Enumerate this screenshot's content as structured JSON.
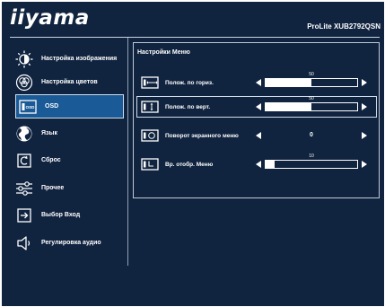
{
  "brand": "iiyama",
  "model": "ProLite XUB2792QSN",
  "colors": {
    "background": "#10233f",
    "selected": "#1a5a96",
    "text": "#ffffff"
  },
  "menu": [
    {
      "label": "Настройка изображения",
      "icon": "sun-brightness-icon"
    },
    {
      "label": "Настройка цветов",
      "icon": "rgb-color-icon"
    },
    {
      "label": "OSD",
      "icon": "osd-icon",
      "selected": true
    },
    {
      "label": "Язык",
      "icon": "globe-icon"
    },
    {
      "label": "Сброс",
      "icon": "reset-icon"
    },
    {
      "label": "Прочее",
      "icon": "sliders-icon"
    },
    {
      "label": "Выбор Вход",
      "icon": "input-icon"
    },
    {
      "label": "Регулировка аудио",
      "icon": "speaker-icon"
    }
  ],
  "panel": {
    "title": "Настройки Меню",
    "rows": [
      {
        "label": "Полож. по гориз.",
        "bar_value": "50",
        "bar_fraction": 0.5,
        "icon": "horizontal-position-icon"
      },
      {
        "label": "Полож. по верт.",
        "bar_value": "50",
        "bar_fraction": 0.5,
        "icon": "vertical-position-icon",
        "selected": true
      },
      {
        "label": "Поворот экранного меню",
        "value": "0",
        "icon": "rotate-icon"
      },
      {
        "label": "Вр. отобр. Меню",
        "bar_value": "10",
        "bar_fraction": 0.1,
        "icon": "clock-icon"
      }
    ]
  }
}
